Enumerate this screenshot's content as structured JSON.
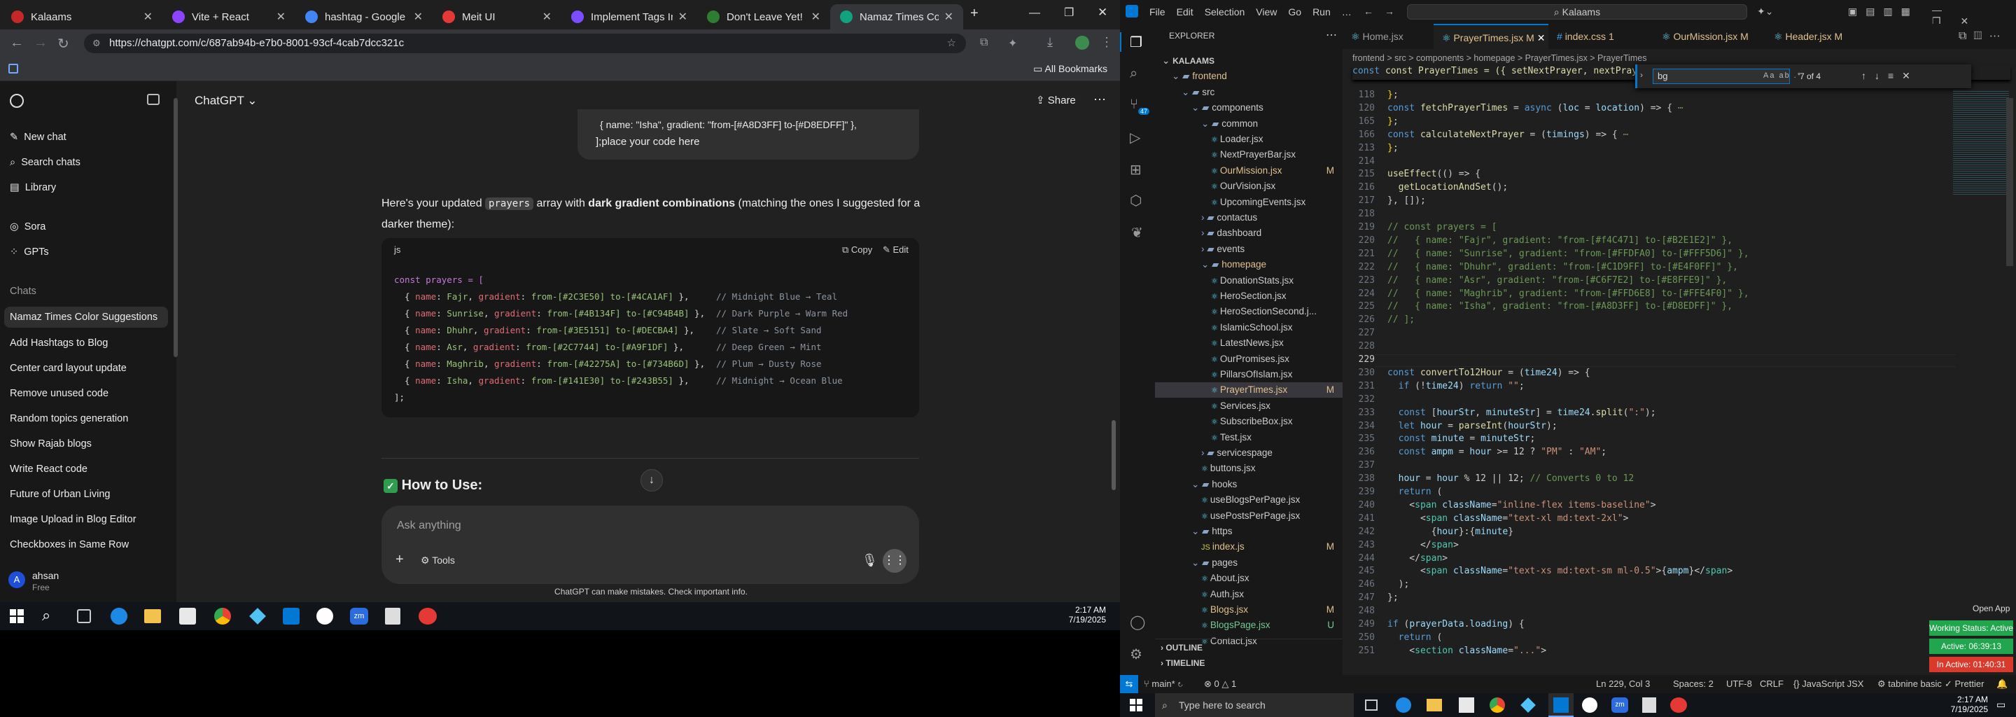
{
  "chrome": {
    "tabs": [
      {
        "label": "Kalaams",
        "color": "#c62828"
      },
      {
        "label": "Vite + React",
        "color": "#8e44ff"
      },
      {
        "label": "hashtag - Google Sea",
        "color": "#4285f4"
      },
      {
        "label": "Meit UI",
        "color": "#e53935"
      },
      {
        "label": "Implement Tags Input",
        "color": "#7c4dff"
      },
      {
        "label": "Don't Leave Yet!",
        "color": "#2e7d32"
      },
      {
        "label": "Namaz Times Color S",
        "color": "#10a37f"
      }
    ],
    "url": "https://chatgpt.com/c/687ab94b-e7b0-8001-93cf-4cab7dcc321c",
    "all_bookmarks": "All Bookmarks"
  },
  "chat": {
    "app_title": "ChatGPT",
    "share": "Share",
    "sidebar": {
      "new_chat": "New chat",
      "search": "Search chats",
      "library": "Library",
      "sora": "Sora",
      "gpts": "GPTs",
      "chats_header": "Chats",
      "chats": [
        "Namaz Times Color Suggestions",
        "Add Hashtags to Blog",
        "Center card layout update",
        "Remove unused code",
        "Random topics generation",
        "Show Rajab blogs",
        "Write React code",
        "Future of Urban Living",
        "Image Upload in Blog Editor",
        "Checkboxes in Same Row"
      ],
      "user_name": "ahsan",
      "user_plan": "Free",
      "user_initial": "A"
    },
    "user_msg_line1": "{ name: \"Isha\", gradient: \"from-[#A8D3FF] to-[#D8EDFF]\" },",
    "user_msg_line2": "];place your code here",
    "reply_a": "Here's your updated ",
    "reply_code": "prayers",
    "reply_b": " array with ",
    "reply_bold": "dark gradient combinations",
    "reply_c": " (matching the ones I suggested for a",
    "reply_d": "darker theme):",
    "code_lang": "js",
    "copy": "Copy",
    "edit": "Edit",
    "code_open": "const prayers = [",
    "code_rows": [
      {
        "name": "Fajr",
        "grad": "from-[#2C3E50] to-[#4CA1AF]",
        "comment": "// Midnight Blue → Teal"
      },
      {
        "name": "Sunrise",
        "grad": "from-[#4B134F] to-[#C94B4B]",
        "comment": "// Dark Purple → Warm Red"
      },
      {
        "name": "Dhuhr",
        "grad": "from-[#3E5151] to-[#DECBA4]",
        "comment": "// Slate → Soft Sand"
      },
      {
        "name": "Asr",
        "grad": "from-[#2C7744] to-[#A9F1DF]",
        "comment": "// Deep Green → Mint"
      },
      {
        "name": "Maghrib",
        "grad": "from-[#42275A] to-[#734B6D]",
        "comment": "// Plum → Dusty Rose"
      },
      {
        "name": "Isha",
        "grad": "from-[#141E30] to-[#243B55]",
        "comment": "// Midnight → Ocean Blue"
      }
    ],
    "code_close": "];",
    "how_to_use": "How to Use:",
    "ask_placeholder": "Ask anything",
    "tools": "Tools",
    "disclaimer": "ChatGPT can make mistakes. Check important info."
  },
  "taskbar_left": {
    "time": "2:17 AM",
    "date": "7/19/2025"
  },
  "vscode": {
    "menu": [
      "File",
      "Edit",
      "Selection",
      "View",
      "Go",
      "Run",
      "…"
    ],
    "search": "Kalaams",
    "explorer_title": "EXPLORER",
    "tree": [
      {
        "label": "KALAAMS",
        "indent": 0,
        "kind": "root"
      },
      {
        "label": "frontend",
        "indent": 1,
        "kind": "dir-open",
        "color": "#e2c08d"
      },
      {
        "label": "src",
        "indent": 2,
        "kind": "dir-open"
      },
      {
        "label": "components",
        "indent": 3,
        "kind": "dir-open"
      },
      {
        "label": "common",
        "indent": 4,
        "kind": "dir-open"
      },
      {
        "label": "Loader.jsx",
        "indent": 5,
        "kind": "file"
      },
      {
        "label": "NextPrayerBar.jsx",
        "indent": 5,
        "kind": "file"
      },
      {
        "label": "OurMission.jsx",
        "indent": 5,
        "kind": "file",
        "badge": "M",
        "color": "#e2c08d"
      },
      {
        "label": "OurVision.jsx",
        "indent": 5,
        "kind": "file"
      },
      {
        "label": "UpcomingEvents.jsx",
        "indent": 5,
        "kind": "file"
      },
      {
        "label": "contactus",
        "indent": 4,
        "kind": "dir"
      },
      {
        "label": "dashboard",
        "indent": 4,
        "kind": "dir"
      },
      {
        "label": "events",
        "indent": 4,
        "kind": "dir"
      },
      {
        "label": "homepage",
        "indent": 4,
        "kind": "dir-open",
        "color": "#e2c08d"
      },
      {
        "label": "DonationStats.jsx",
        "indent": 5,
        "kind": "file"
      },
      {
        "label": "HeroSection.jsx",
        "indent": 5,
        "kind": "file"
      },
      {
        "label": "HeroSectionSecond.j...",
        "indent": 5,
        "kind": "file"
      },
      {
        "label": "IslamicSchool.jsx",
        "indent": 5,
        "kind": "file"
      },
      {
        "label": "LatestNews.jsx",
        "indent": 5,
        "kind": "file"
      },
      {
        "label": "OurPromises.jsx",
        "indent": 5,
        "kind": "file"
      },
      {
        "label": "PillarsOfIslam.jsx",
        "indent": 5,
        "kind": "file"
      },
      {
        "label": "PrayerTimes.jsx",
        "indent": 5,
        "kind": "file",
        "badge": "M",
        "color": "#e2c08d",
        "selected": true
      },
      {
        "label": "Services.jsx",
        "indent": 5,
        "kind": "file"
      },
      {
        "label": "SubscribeBox.jsx",
        "indent": 5,
        "kind": "file"
      },
      {
        "label": "Test.jsx",
        "indent": 5,
        "kind": "file"
      },
      {
        "label": "servicespage",
        "indent": 4,
        "kind": "dir"
      },
      {
        "label": "buttons.jsx",
        "indent": 4,
        "kind": "file"
      },
      {
        "label": "hooks",
        "indent": 3,
        "kind": "dir-open"
      },
      {
        "label": "useBlogsPerPage.jsx",
        "indent": 4,
        "kind": "file"
      },
      {
        "label": "usePostsPerPage.jsx",
        "indent": 4,
        "kind": "file"
      },
      {
        "label": "https",
        "indent": 3,
        "kind": "dir-open"
      },
      {
        "label": "index.js",
        "indent": 4,
        "kind": "file",
        "badge": "M",
        "color": "#e2c08d"
      },
      {
        "label": "pages",
        "indent": 3,
        "kind": "dir-open"
      },
      {
        "label": "About.jsx",
        "indent": 4,
        "kind": "file"
      },
      {
        "label": "Auth.jsx",
        "indent": 4,
        "kind": "file"
      },
      {
        "label": "Blogs.jsx",
        "indent": 4,
        "kind": "file",
        "badge": "M",
        "color": "#e2c08d"
      },
      {
        "label": "BlogsPage.jsx",
        "indent": 4,
        "kind": "file",
        "badge": "U",
        "color": "#73c991"
      },
      {
        "label": "Contact.jsx",
        "indent": 4,
        "kind": "file"
      }
    ],
    "outline": "OUTLINE",
    "timeline": "TIMELINE",
    "editor_tabs": [
      {
        "label": "Home.jsx",
        "badge": ""
      },
      {
        "label": "PrayerTimes.jsx",
        "badge": "M",
        "active": true
      },
      {
        "label": "index.css",
        "badge": "1"
      },
      {
        "label": "OurMission.jsx",
        "badge": "M"
      },
      {
        "label": "Header.jsx",
        "badge": "M"
      }
    ],
    "breadcrumb": "frontend > src > components > homepage > PrayerTimes.jsx > PrayerTimes",
    "sticky_line": "const PrayerTimes = ({ setNextPrayer, nextPrayer }) => {",
    "find_value": "bg",
    "find_count": "7 of 4",
    "status": {
      "branch": "main*",
      "problems": "0",
      "warnings": "1",
      "position": "Ln 229, Col 3",
      "spaces": "Spaces: 2",
      "encoding": "UTF-8",
      "eol": "CRLF",
      "language": "JavaScript JSX",
      "tabnine": "tabnine basic",
      "prettier": "Prettier"
    },
    "open_app": "Open App",
    "working_status": "Working Status: Active",
    "active_time": "Active: 06:39:13",
    "inactive_time": "In Active: 01:40:31"
  },
  "taskbar_right": {
    "search_placeholder": "Type here to search",
    "time": "2:17 AM",
    "date": "7/19/2025"
  }
}
